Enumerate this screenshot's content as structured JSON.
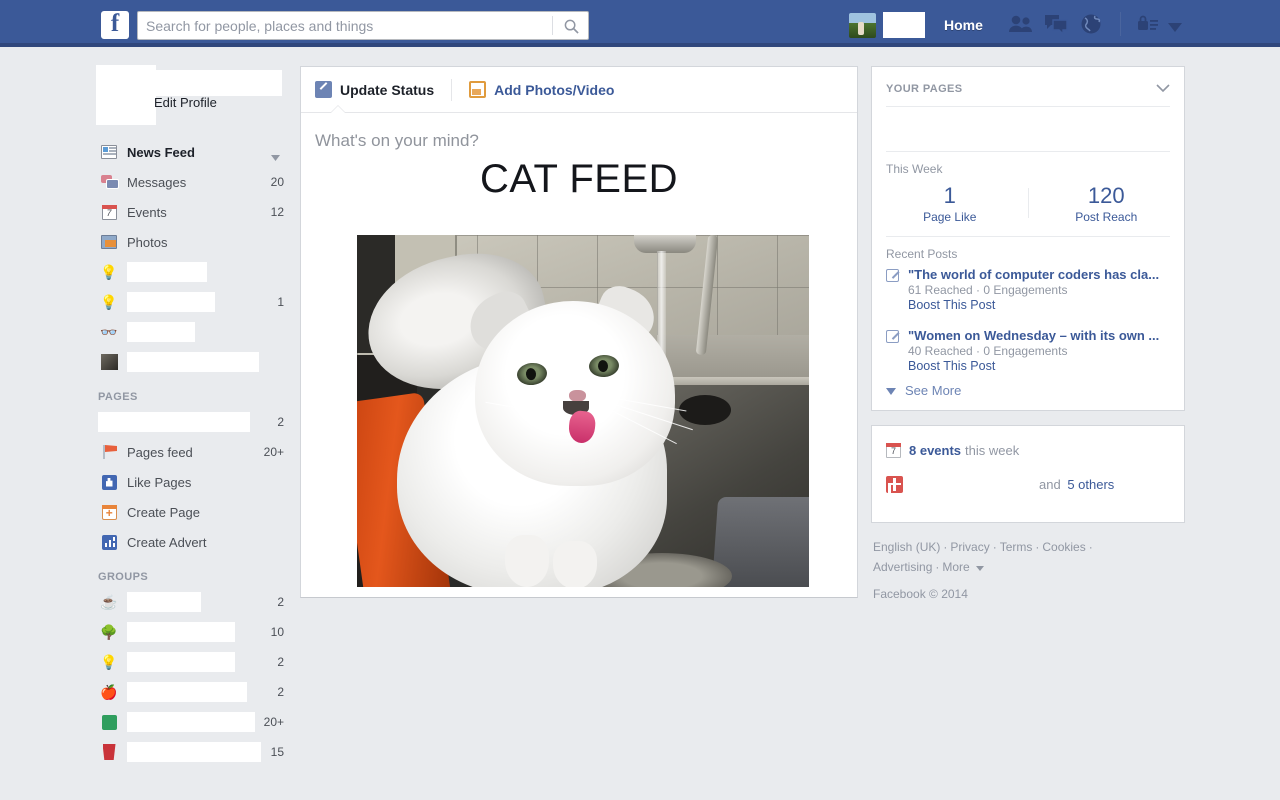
{
  "topbar": {
    "logo": "f",
    "search": {
      "placeholder": "Search for people, places and things",
      "value": "",
      "icon": "search-icon"
    },
    "home_label": "Home",
    "icons": [
      "friends-icon",
      "messages-icon",
      "globe-icon",
      "privacy-lock-icon",
      "account-caret-icon"
    ]
  },
  "sidebar": {
    "edit_profile": "Edit Profile",
    "items": [
      {
        "label": "News Feed",
        "count": "",
        "icon": "news-feed-icon",
        "bold": true,
        "chevron": true
      },
      {
        "label": "Messages",
        "count": "20",
        "icon": "messages-icon"
      },
      {
        "label": "Events",
        "count": "12",
        "icon": "calendar-icon",
        "day": "7"
      },
      {
        "label": "Photos",
        "count": "",
        "icon": "photos-icon"
      },
      {
        "label": "",
        "count": "",
        "icon": "lightbulb-icon",
        "redacted": 80
      },
      {
        "label": "",
        "count": "1",
        "icon": "lightbulb-icon",
        "redacted": 88
      },
      {
        "label": "",
        "count": "",
        "icon": "glasses-icon",
        "redacted": 68
      },
      {
        "label": "",
        "count": "",
        "icon": "thumbnail-icon",
        "redacted": 132
      }
    ],
    "pages_header": "Pages",
    "pages_items": [
      {
        "label": "",
        "count": "2",
        "icon": "page-thumb-icon",
        "redacted": 152
      },
      {
        "label": "Pages feed",
        "count": "20+",
        "icon": "flag-icon"
      },
      {
        "label": "Like Pages",
        "count": "",
        "icon": "thumbs-up-icon"
      },
      {
        "label": "Create Page",
        "count": "",
        "icon": "create-page-icon"
      },
      {
        "label": "Create Advert",
        "count": "",
        "icon": "bar-chart-icon"
      }
    ],
    "groups_header": "Groups",
    "groups_items": [
      {
        "label": "",
        "count": "2",
        "icon": "coffee-mug-icon",
        "redacted": 74
      },
      {
        "label": "",
        "count": "10",
        "icon": "tree-icon",
        "redacted": 108
      },
      {
        "label": "",
        "count": "2",
        "icon": "lightbulb-icon",
        "redacted": 108
      },
      {
        "label": "",
        "count": "2",
        "icon": "apple-icon",
        "redacted": 120
      },
      {
        "label": "",
        "count": "20+",
        "icon": "microchip-icon",
        "redacted": 128
      },
      {
        "label": "",
        "count": "15",
        "icon": "red-cup-icon",
        "redacted": 134
      }
    ]
  },
  "composer": {
    "tab_status": "Update Status",
    "tab_photo": "Add Photos/Video",
    "placeholder": "What's on your mind?",
    "post_title": "CAT FEED",
    "photo_alt": "white cat in kitchen sink under running tap"
  },
  "right": {
    "pages_card_title": "Your Pages",
    "this_week_label": "This Week",
    "stats": [
      {
        "value": "1",
        "caption": "Page Like"
      },
      {
        "value": "120",
        "caption": "Post Reach"
      }
    ],
    "recent_posts_label": "Recent Posts",
    "posts": [
      {
        "title": "\"The world of computer coders has cla...",
        "meta": "61 Reached · 0 Engagements",
        "boost": "Boost This Post"
      },
      {
        "title": "\"Women on Wednesday – with its own ...",
        "meta": "40 Reached · 0 Engagements",
        "boost": "Boost This Post"
      }
    ],
    "see_more": "See More",
    "events": {
      "count_link": "8 events",
      "count_suffix": "this week",
      "day": "7",
      "others_prefix": "and",
      "others_link": "5 others"
    },
    "footer_links": [
      "English (UK)",
      "Privacy",
      "Terms",
      "Cookies",
      "Advertising",
      "More"
    ],
    "copyright": "Facebook © 2014"
  },
  "colors": {
    "brand_blue": "#3b5998",
    "link_blue": "#3b5998",
    "page_bg": "#e9ebee",
    "muted": "#9197a3"
  }
}
